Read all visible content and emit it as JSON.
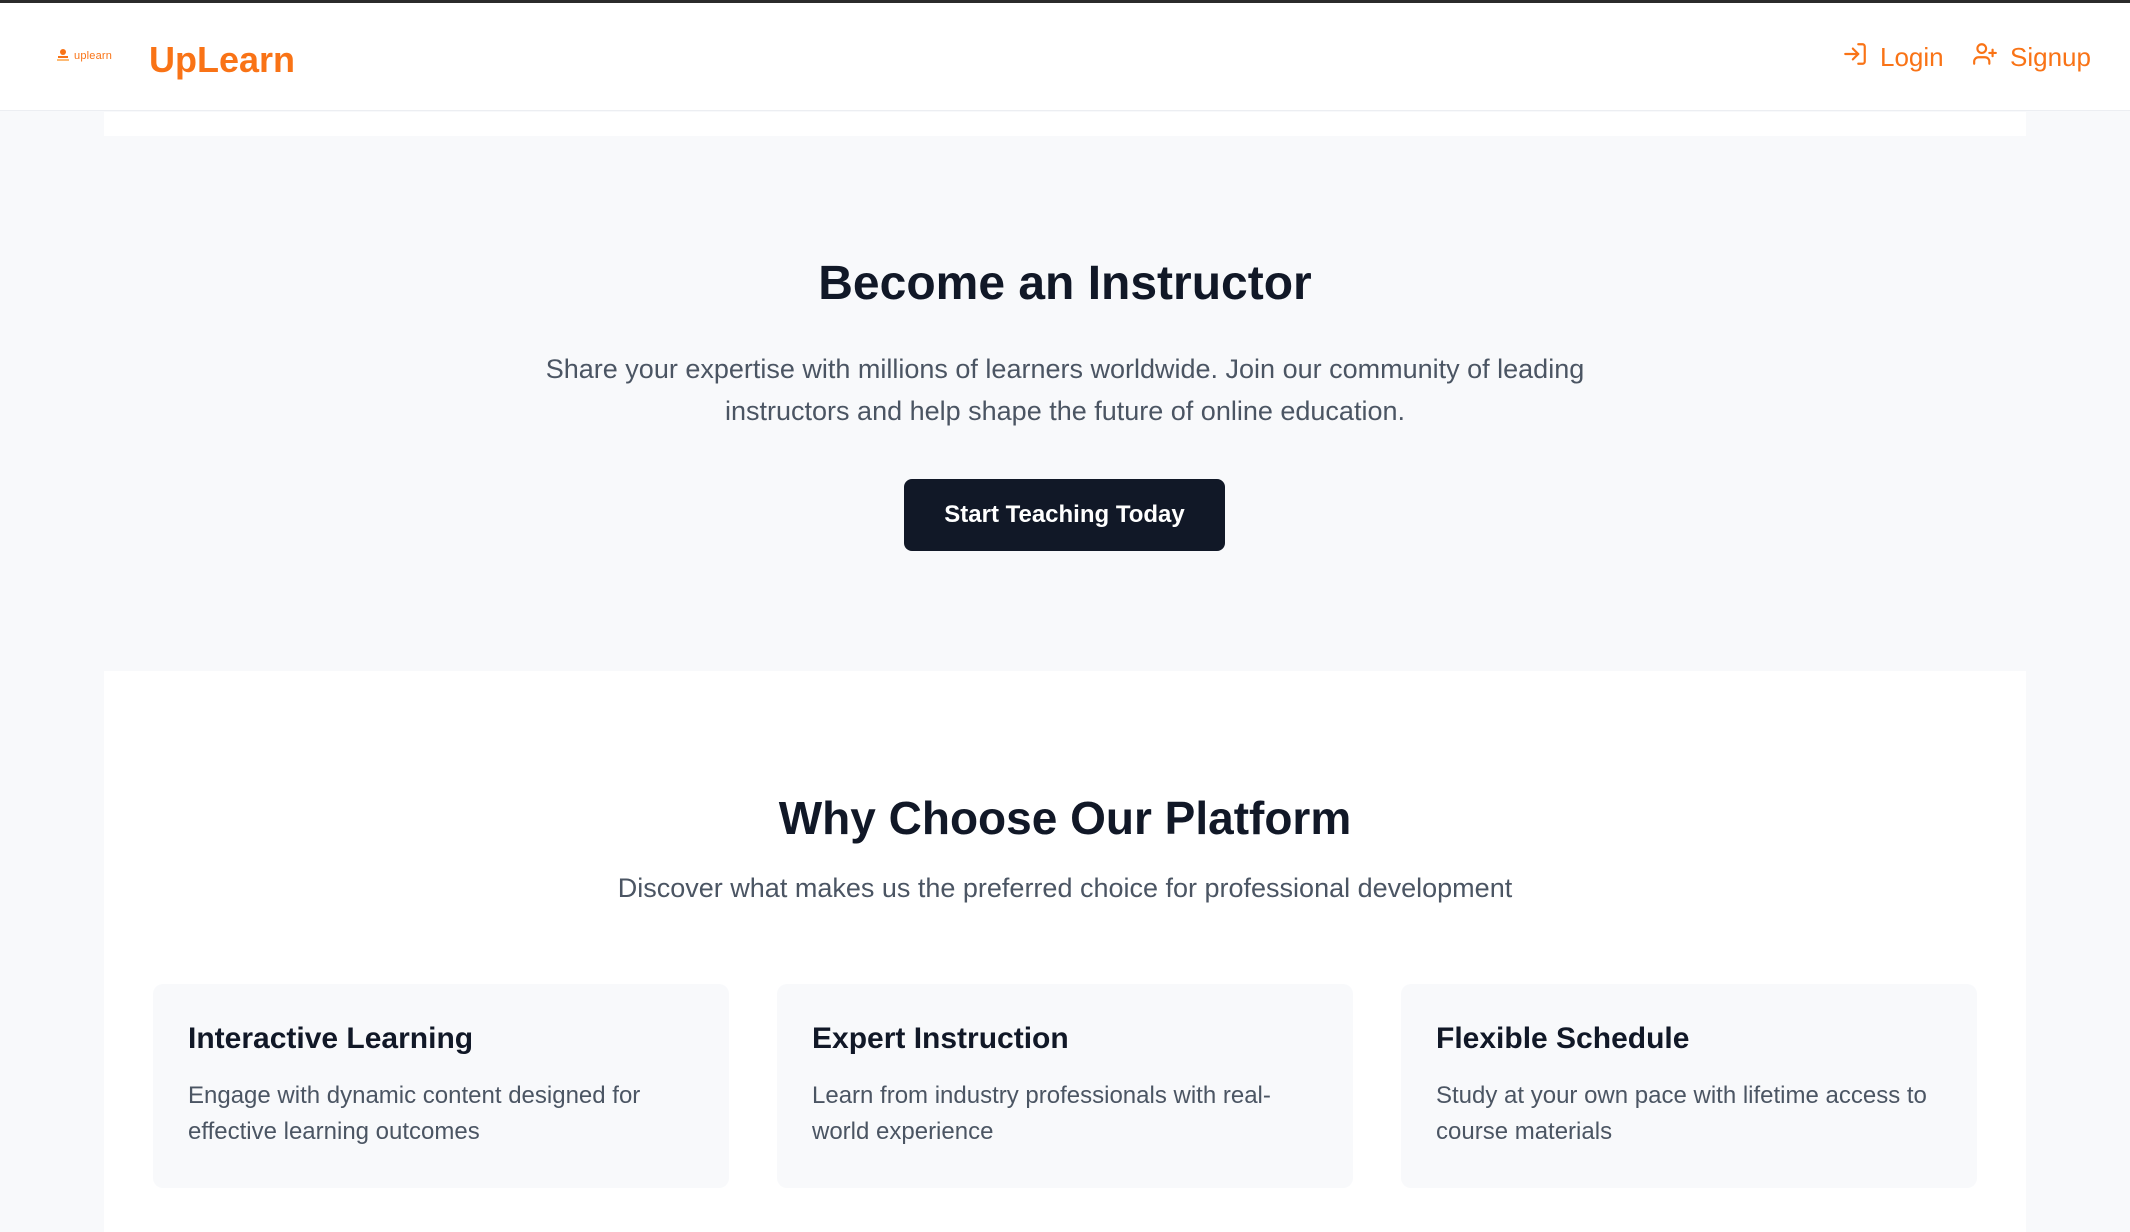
{
  "header": {
    "logo_text": "uplearn",
    "brand": "UpLearn",
    "login_label": "Login",
    "signup_label": "Signup",
    "accent_color": "#f97316"
  },
  "hero": {
    "title": "Become an Instructor",
    "subtitle": "Share your expertise with millions of learners worldwide. Join our community of leading instructors and help shape the future of online education.",
    "cta_label": "Start Teaching Today"
  },
  "features": {
    "title": "Why Choose Our Platform",
    "subtitle": "Discover what makes us the preferred choice for professional development",
    "cards": [
      {
        "title": "Interactive Learning",
        "description": "Engage with dynamic content designed for effective learning outcomes"
      },
      {
        "title": "Expert Instruction",
        "description": "Learn from industry professionals with real-world experience"
      },
      {
        "title": "Flexible Schedule",
        "description": "Study at your own pace with lifetime access to course materials"
      }
    ]
  },
  "icons": {
    "login": "login-icon",
    "signup": "user-plus-icon",
    "logo": "logo-icon"
  }
}
